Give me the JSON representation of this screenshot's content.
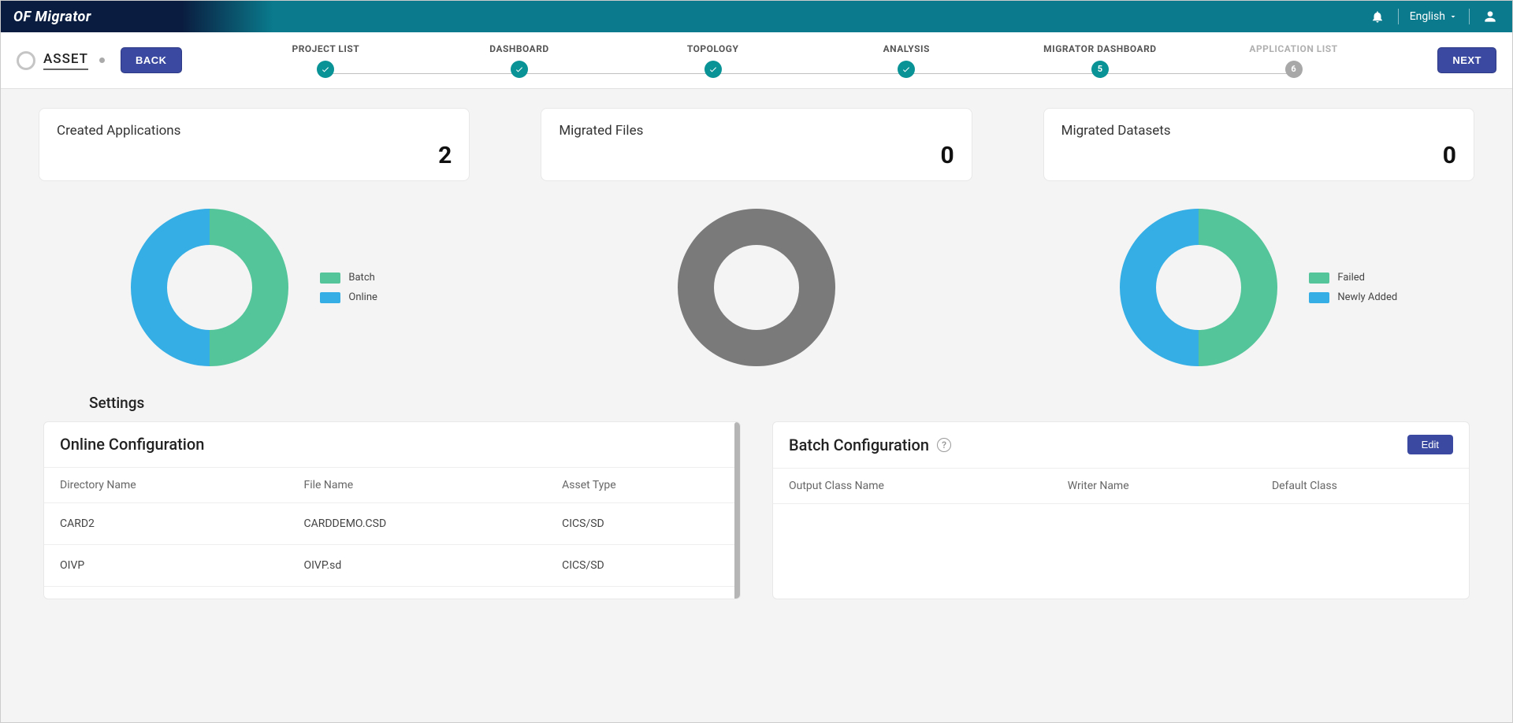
{
  "app": {
    "title": "OF Migrator"
  },
  "topbar": {
    "language": "English"
  },
  "stepbar": {
    "asset_label": "ASSET",
    "back": "BACK",
    "next": "NEXT",
    "steps": [
      {
        "label": "PROJECT LIST",
        "state": "done"
      },
      {
        "label": "DASHBOARD",
        "state": "done"
      },
      {
        "label": "TOPOLOGY",
        "state": "done"
      },
      {
        "label": "ANALYSIS",
        "state": "done"
      },
      {
        "label": "MIGRATOR DASHBOARD",
        "state": "current",
        "num": "5"
      },
      {
        "label": "APPLICATION LIST",
        "state": "inactive",
        "num": "6"
      }
    ]
  },
  "stats": {
    "created_apps": {
      "title": "Created Applications",
      "value": "2"
    },
    "migrated_files": {
      "title": "Migrated Files",
      "value": "0"
    },
    "migrated_datasets": {
      "title": "Migrated Datasets",
      "value": "0"
    }
  },
  "chart_data": [
    {
      "type": "pie",
      "title": "Created Applications",
      "series": [
        {
          "name": "Batch",
          "value": 1,
          "color": "#54c49a"
        },
        {
          "name": "Online",
          "value": 1,
          "color": "#34aee4"
        }
      ]
    },
    {
      "type": "pie",
      "title": "Migrated Files",
      "series": [],
      "empty_color": "#7a7a7a"
    },
    {
      "type": "pie",
      "title": "Migrated Datasets",
      "series": [
        {
          "name": "Failed",
          "value": 1,
          "color": "#54c49a"
        },
        {
          "name": "Newly Added",
          "value": 1,
          "color": "#34aee4"
        }
      ]
    }
  ],
  "legends": {
    "apps": [
      {
        "label": "Batch",
        "color": "#54c49a"
      },
      {
        "label": "Online",
        "color": "#34aee4"
      }
    ],
    "datasets": [
      {
        "label": "Failed",
        "color": "#54c49a"
      },
      {
        "label": "Newly Added",
        "color": "#34aee4"
      }
    ]
  },
  "settings": {
    "heading": "Settings",
    "online": {
      "title": "Online Configuration",
      "columns": [
        "Directory Name",
        "File Name",
        "Asset Type"
      ],
      "rows": [
        {
          "dir": "CARD2",
          "file": "CARDDEMO.CSD",
          "type": "CICS/SD"
        },
        {
          "dir": "OIVP",
          "file": "OIVP.sd",
          "type": "CICS/SD"
        }
      ]
    },
    "batch": {
      "title": "Batch Configuration",
      "edit": "Edit",
      "columns": [
        "Output Class Name",
        "Writer Name",
        "Default Class"
      ],
      "rows": []
    }
  }
}
